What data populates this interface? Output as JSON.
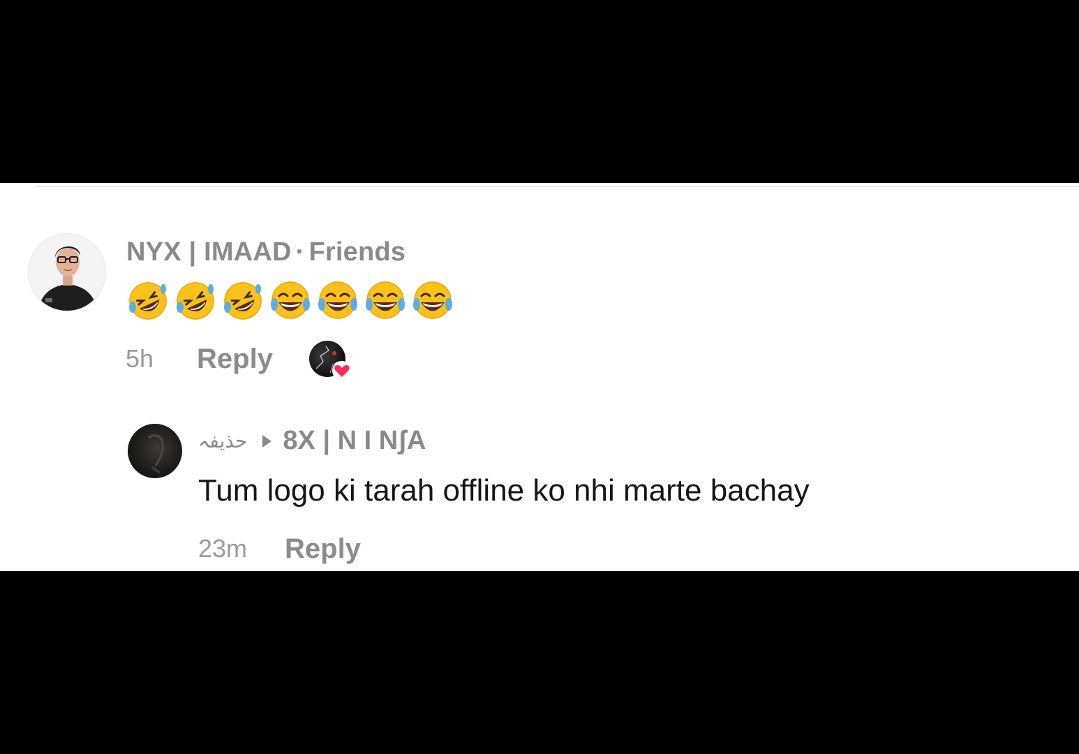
{
  "comment": {
    "username": "NYX | IMAAD",
    "separator": "·",
    "relationship": "Friends",
    "emojis": [
      "rofl",
      "rofl",
      "rofl",
      "joy",
      "joy",
      "joy",
      "joy"
    ],
    "time": "5h",
    "reply_label": "Reply",
    "liked_by_creator_icon": "heart-icon",
    "heart_color": "#fe2c55"
  },
  "reply": {
    "author_name": "حذيفہ",
    "reply_to_icon": "play-triangle-icon",
    "reply_to_name": "8X | N I NʃA",
    "text": "Tum logo ki tarah offline ko nhi marte bachay",
    "time": "23m",
    "reply_label": "Reply"
  }
}
